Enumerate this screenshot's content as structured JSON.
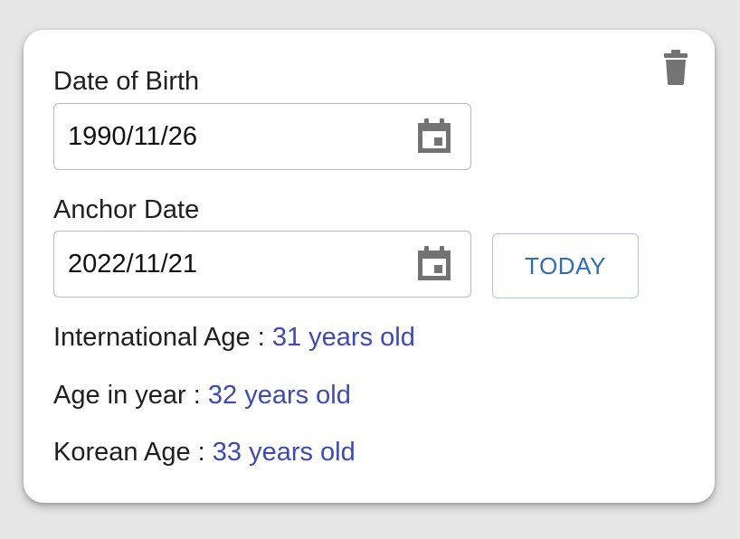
{
  "colors": {
    "background": "#e6e6e6",
    "card": "#ffffff",
    "accent_text": "#3d4bb0",
    "button_text": "#2f6db8",
    "icon": "#737373"
  },
  "icons": {
    "delete": "trash-icon",
    "calendar": "calendar-icon"
  },
  "date_of_birth": {
    "label": "Date of Birth",
    "value": "1990/11/26"
  },
  "anchor_date": {
    "label": "Anchor Date",
    "value": "2022/11/21",
    "today_button": "TODAY"
  },
  "ages": [
    {
      "label": "International Age : ",
      "value": "31 years old"
    },
    {
      "label": "Age in year : ",
      "value": "32 years old"
    },
    {
      "label": "Korean Age : ",
      "value": "33 years old"
    }
  ]
}
